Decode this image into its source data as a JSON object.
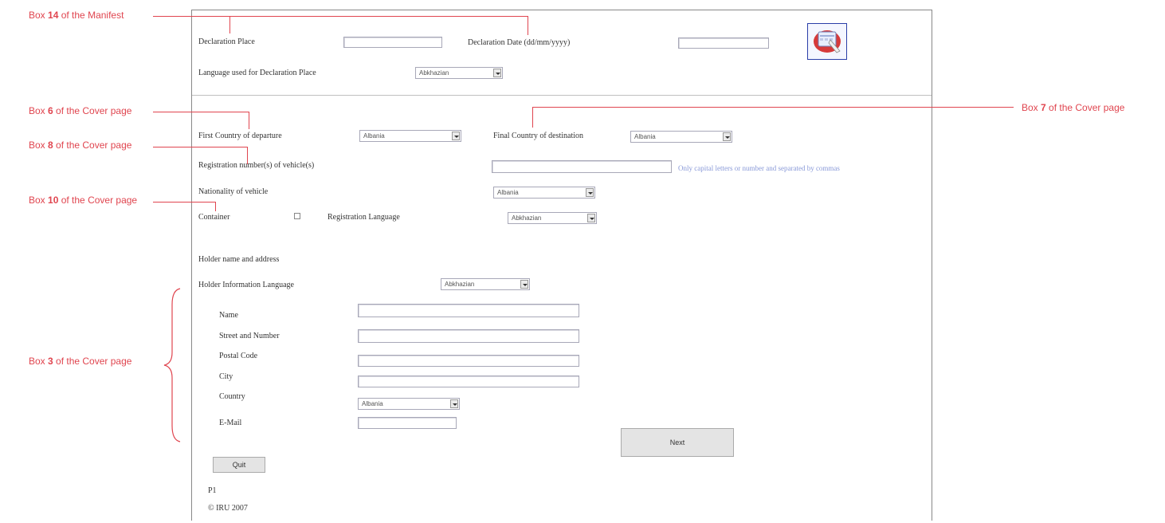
{
  "annotations": {
    "box14": {
      "pre": "Box ",
      "num": "14",
      "post": " of the Manifest"
    },
    "box6": {
      "pre": "Box ",
      "num": "6",
      "post": " of the Cover page"
    },
    "box8": {
      "pre": "Box ",
      "num": "8",
      "post": " of the Cover page"
    },
    "box10": {
      "pre": "Box ",
      "num": "10",
      "post": " of the Cover page"
    },
    "box3": {
      "pre": "Box ",
      "num": "3",
      "post": " of the Cover page"
    },
    "box7": {
      "pre": "Box ",
      "num": "7",
      "post": " of the Cover page"
    }
  },
  "header": {
    "declaration_place_label": "Declaration Place",
    "declaration_place_value": "",
    "declaration_date_label": "Declaration Date (dd/mm/yyyy)",
    "declaration_date_value": "",
    "language_label": "Language used for Declaration Place",
    "language_value": "Abkhazian"
  },
  "route": {
    "first_country_label": "First Country of departure",
    "first_country_value": "Albania",
    "final_country_label": "Final Country of destination",
    "final_country_value": "Albania"
  },
  "vehicle": {
    "registration_label": "Registration number(s) of vehicle(s)",
    "registration_value": "",
    "registration_hint": "Only capital letters or number and separated by commas",
    "nationality_label": "Nationality of vehicle",
    "nationality_value": "Albania",
    "container_label": "Container",
    "registration_language_label": "Registration Language",
    "registration_language_value": "Abkhazian"
  },
  "holder": {
    "section_label": "Holder name and address",
    "info_language_label": "Holder Information Language",
    "info_language_value": "Abkhazian",
    "name_label": "Name",
    "street_label": "Street and Number",
    "postal_label": "Postal Code",
    "city_label": "City",
    "country_label": "Country",
    "country_value": "Albania",
    "email_label": "E-Mail"
  },
  "buttons": {
    "next": "Next",
    "quit": "Quit"
  },
  "footer": {
    "page": "P1",
    "copyright": "© IRU 2007"
  },
  "colors": {
    "annotation": "#e0454f",
    "hint": "#8a9ad8"
  },
  "icons": [
    "calendar-icon"
  ]
}
